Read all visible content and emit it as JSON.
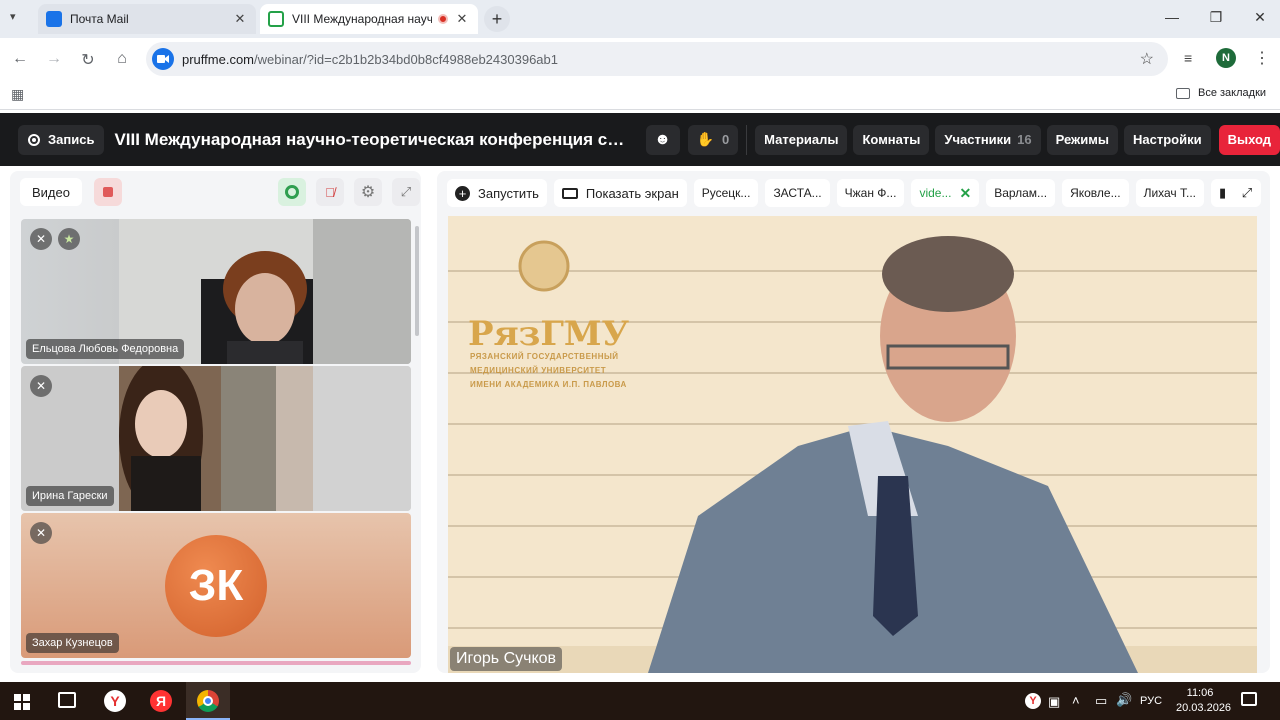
{
  "browser": {
    "tabs": [
      {
        "title": "Почта Mail",
        "active": false
      },
      {
        "title": "VIII Международная научн",
        "active": true
      }
    ],
    "url_host": "pruffme.com",
    "url_path": "/webinar/?id=c2b1b2b34bd0b8cf4988eb2430396ab1",
    "profile_initial": "N",
    "bookmarks_label": "Все закладки"
  },
  "header": {
    "record_label": "Запись",
    "title": "VIII Международная научно-теоретическая конференция сту...",
    "hand_count": "0",
    "materials": "Материалы",
    "rooms": "Комнаты",
    "participants": "Участники",
    "participants_count": "16",
    "modes": "Режимы",
    "settings": "Настройки",
    "exit": "Выход"
  },
  "left": {
    "video_label": "Видео",
    "participants": [
      {
        "name": "Ельцова Любовь Федоровна"
      },
      {
        "name": "Ирина Гарески"
      },
      {
        "name": "Захар Кузнецов",
        "initials": "ЗК"
      }
    ]
  },
  "right": {
    "launch_label": "Запустить",
    "share_label": "Показать экран",
    "stream_tabs": [
      "Русецк...",
      "ЗАСТА...",
      "Чжан Ф...",
      "vide...",
      "Варлам...",
      "Яковле...",
      "Лихач Т..."
    ],
    "bookmark_count": "7",
    "speaker_name": "Игорь Сучков",
    "logo_text": "РязГМУ",
    "logo_line1": "РЯЗАНСКИЙ ГОСУДАРСТВЕННЫЙ",
    "logo_line2": "МЕДИЦИНСКИЙ УНИВЕРСИТЕТ",
    "logo_line3": "ИМЕНИ АКАДЕМИКА И.П. ПАВЛОВА"
  },
  "taskbar": {
    "lang": "РУС",
    "time": "11:06",
    "date": "20.03.2026"
  }
}
